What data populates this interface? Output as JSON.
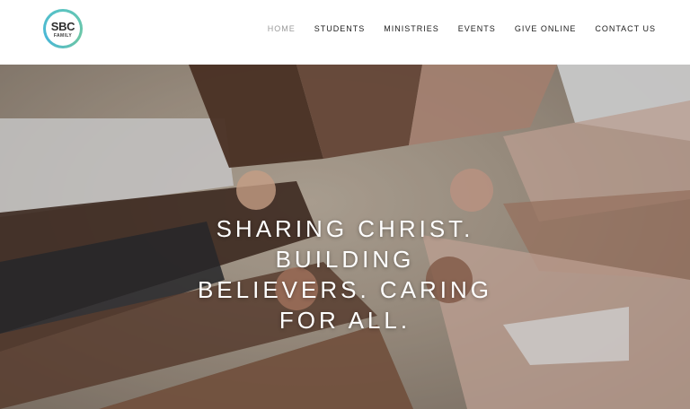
{
  "brand": {
    "logo_main": "SBC",
    "logo_sub": "FAMILY",
    "ring_color": "#5bc4c0"
  },
  "nav": {
    "items": [
      {
        "label": "HOME",
        "active": true
      },
      {
        "label": "STUDENTS"
      },
      {
        "label": "MINISTRIES"
      },
      {
        "label": "EVENTS"
      },
      {
        "label": "GIVE ONLINE"
      },
      {
        "label": "CONTACT US"
      }
    ]
  },
  "hero": {
    "title_lines": [
      "SHARING CHRIST.",
      "BUILDING",
      "BELIEVERS. CARING",
      "FOR ALL."
    ],
    "image": "hands-holding-circle-photo"
  }
}
